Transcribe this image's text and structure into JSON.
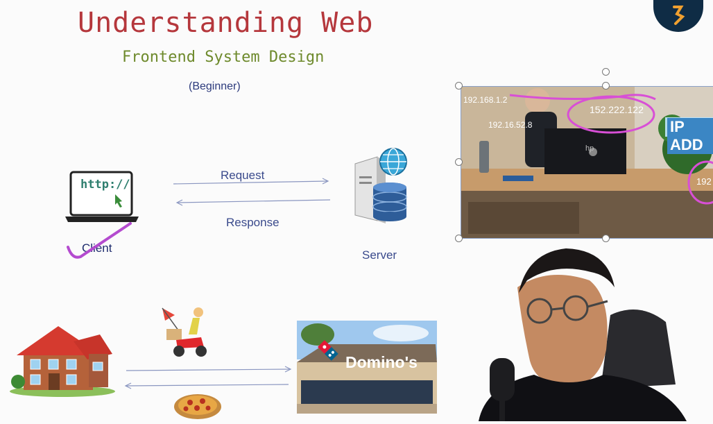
{
  "slide": {
    "title": "Understanding Web",
    "subtitle": "Frontend System Design",
    "level": "(Beginner)"
  },
  "diagram": {
    "client_label": "Client",
    "browser_text": "http://",
    "server_label": "Server",
    "request_label": "Request",
    "response_label": "Response"
  },
  "photo": {
    "ip_addresses": [
      "192.168.1.2",
      "192.16.52.8",
      "152.222.122",
      "192"
    ],
    "banner_text": "IP ADD",
    "laptop_brand": "hp"
  },
  "analogy": {
    "store_sign": "Domino's"
  },
  "colors": {
    "title": "#b5373c",
    "subtitle": "#6e8a2c",
    "label": "#3a4a8c",
    "annotation": "#b44bcf"
  },
  "icons": [
    "laptop-icon",
    "server-icon",
    "globe-icon",
    "house-icon",
    "delivery-scooter-icon",
    "pizza-icon",
    "brand-logo-icon"
  ]
}
